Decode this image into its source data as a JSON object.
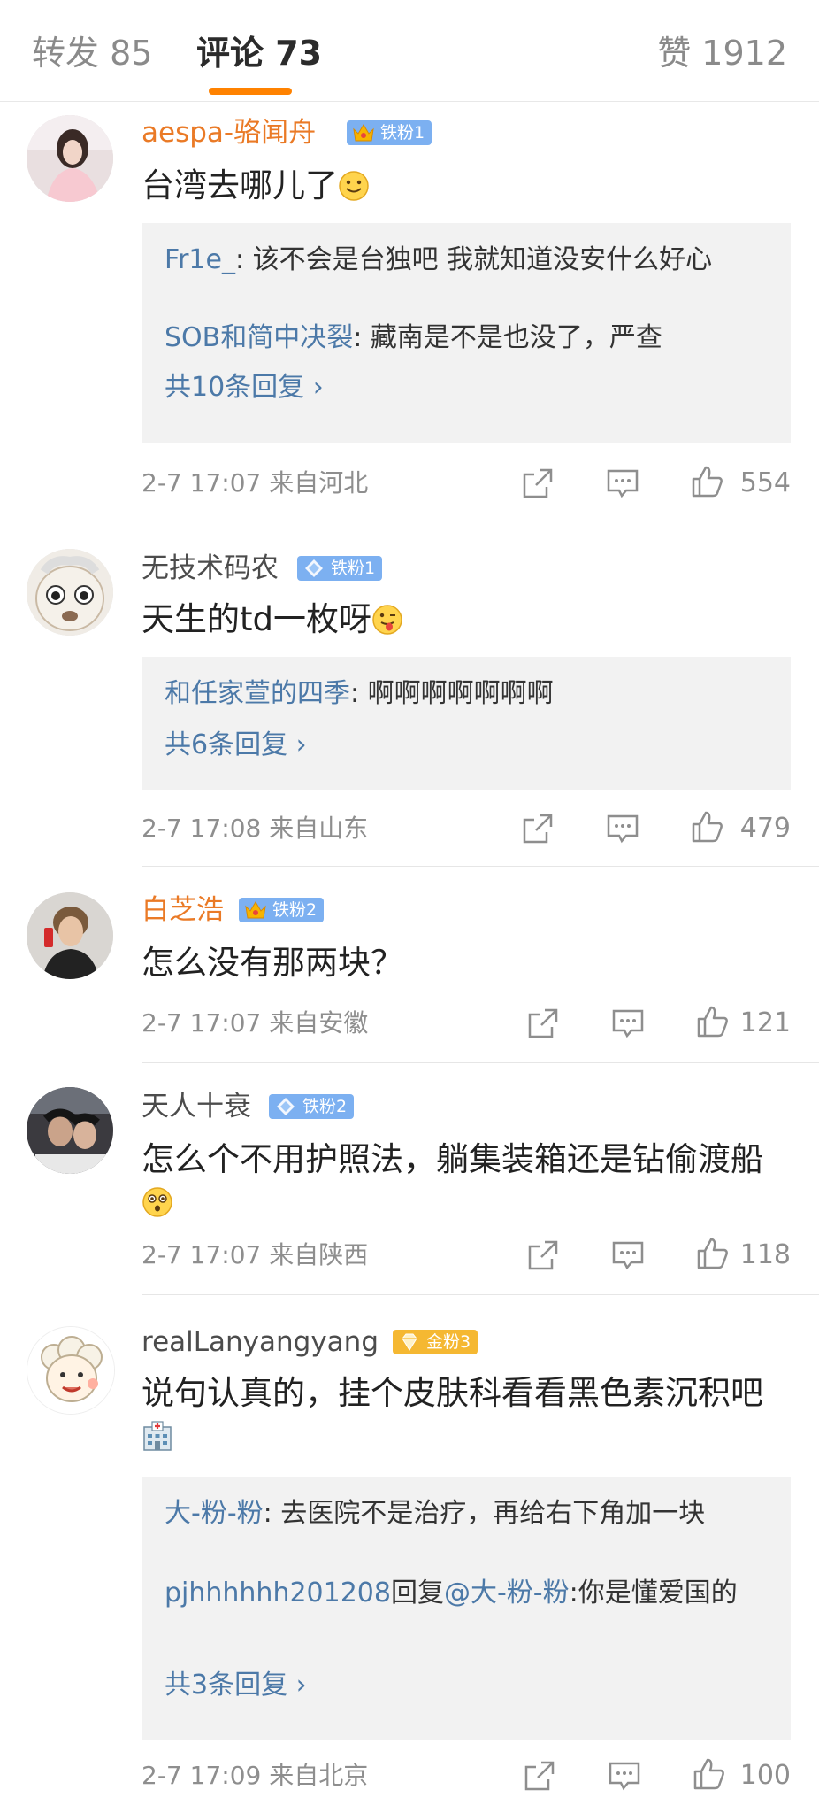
{
  "tabs": {
    "repost": "转发 85",
    "comments": "评论 73",
    "likes": "赞 1912"
  },
  "colors": {
    "accent": "#ff8200",
    "link": "#4c79a8",
    "vip_name": "#ea7a26",
    "fan_blue": "#7cb0f1",
    "fan_gold": "#f5b832"
  },
  "comments": [
    {
      "user": "aespa-骆闻舟",
      "badge": "铁粉1",
      "text": "台湾去哪儿了",
      "emoji": "smile-emoji",
      "replies": [
        {
          "name": "Fr1e_",
          "text": ": 该不会是台独吧 我就知道没安什么好心"
        },
        {
          "name": "SOB和简中决裂",
          "text": ": 藏南是不是也没了，严查"
        }
      ],
      "more": "共10条回复 ›",
      "time": "2-7 17:07 来自河北",
      "likes": "554"
    },
    {
      "user": "无技术码农",
      "badge": "铁粉1",
      "text": "天生的td一枚呀",
      "emoji": "tongue-emoji",
      "replies": [
        {
          "name": "和任家萱的四季",
          "text": ": 啊啊啊啊啊啊啊"
        }
      ],
      "more": "共6条回复 ›",
      "time": "2-7 17:08 来自山东",
      "likes": "479"
    },
    {
      "user": "白芝浩",
      "badge": "铁粉2",
      "text": "怎么没有那两块？",
      "time": "2-7 17:07 来自安徽",
      "likes": "121"
    },
    {
      "user": "天人十衰",
      "badge": "铁粉2",
      "text": "怎么个不用护照法，躺集装箱还是钻偷渡船",
      "emoji": "surprised-emoji",
      "time": "2-7 17:07 来自陕西",
      "likes": "118"
    },
    {
      "user": "realLanyangyang",
      "badge": "金粉3",
      "text": "说句认真的，挂个皮肤科看看黑色素沉积吧",
      "emoji": "hospital-emoji",
      "replies": [
        {
          "name": "大-粉-粉",
          "text": ": 去医院不是治疗，再给右下角加一块"
        },
        {
          "name": "pjhhhhhh201208",
          "mid": "回复",
          "name2": "@大-粉-粉",
          "text": ":你是懂爱国的"
        }
      ],
      "more": "共3条回复 ›",
      "time": "2-7 17:09 来自北京",
      "likes": "100"
    }
  ]
}
